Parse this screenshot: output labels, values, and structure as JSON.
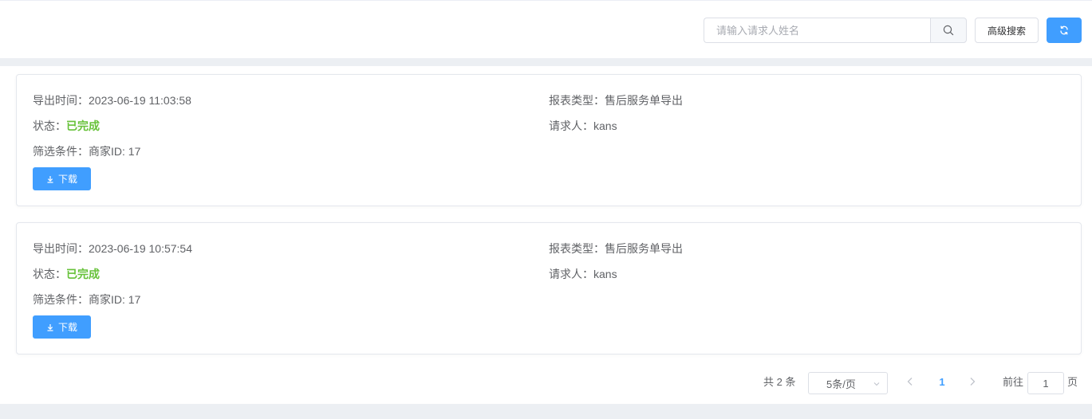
{
  "toolbar": {
    "search_placeholder": "请输入请求人姓名",
    "search_value": "",
    "advanced_search_label": "高级搜索",
    "search_icon": "search-icon",
    "refresh_icon": "refresh-icon"
  },
  "colors": {
    "primary": "#409eff",
    "success": "#67c23a",
    "text": "#606266",
    "border": "#dcdfe6",
    "band": "#eceff3"
  },
  "records": [
    {
      "export_time_label": "导出时间：",
      "export_time": "2023-06-19 11:03:58",
      "status_label": "状态：",
      "status": "已完成",
      "filter_label": "筛选条件：",
      "filter": "商家ID: 17",
      "report_type_label": "报表类型：",
      "report_type": "售后服务单导出",
      "requester_label": "请求人：",
      "requester": "kans",
      "download_label": "下载"
    },
    {
      "export_time_label": "导出时间：",
      "export_time": "2023-06-19 10:57:54",
      "status_label": "状态：",
      "status": "已完成",
      "filter_label": "筛选条件：",
      "filter": "商家ID: 17",
      "report_type_label": "报表类型：",
      "report_type": "售后服务单导出",
      "requester_label": "请求人：",
      "requester": "kans",
      "download_label": "下载"
    }
  ],
  "pagination": {
    "total_text": "共 2 条",
    "page_size": "5条/页",
    "current_page": "1",
    "goto_label": "前往",
    "goto_value": "1",
    "goto_suffix": "页"
  }
}
